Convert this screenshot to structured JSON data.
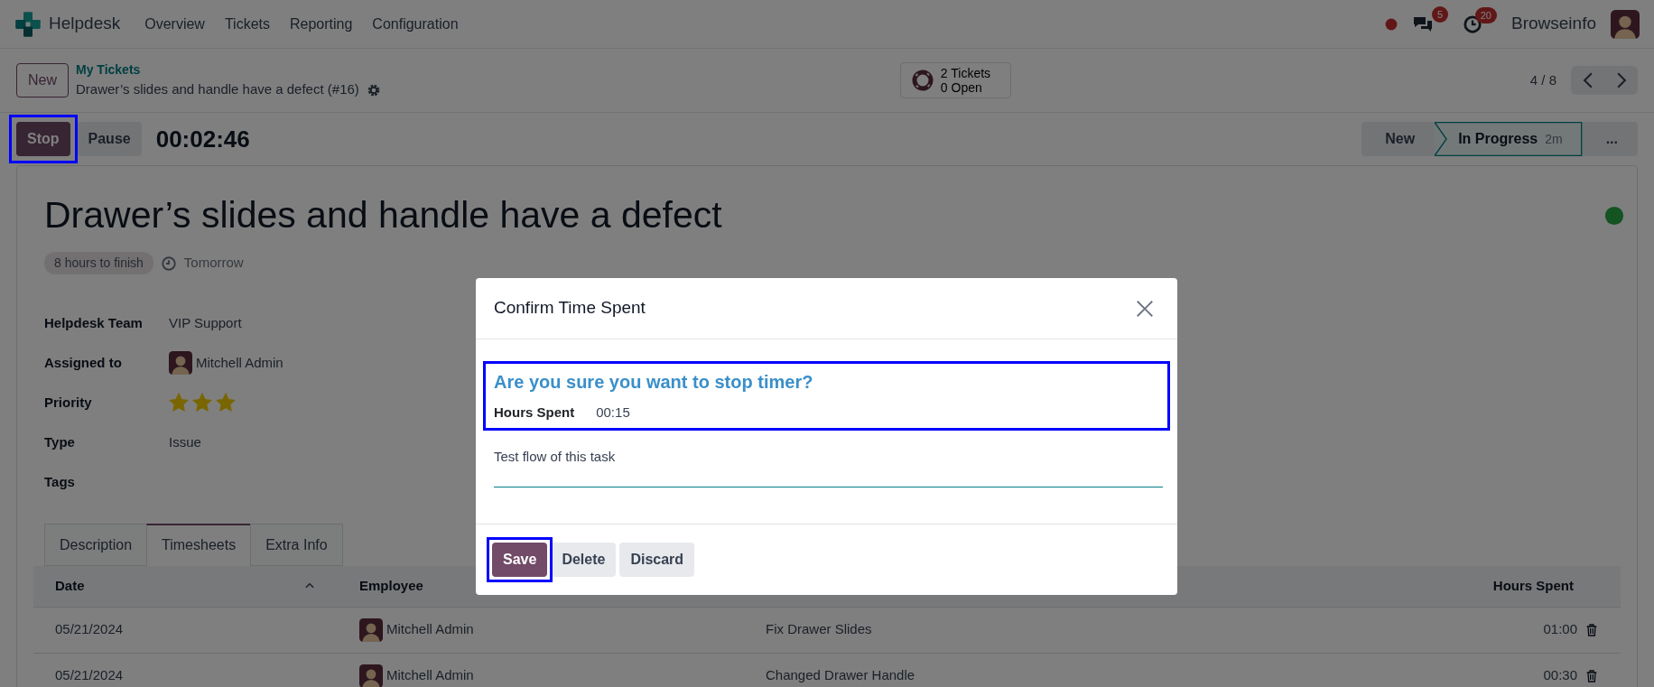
{
  "navbar": {
    "app": "Helpdesk",
    "menus": [
      "Overview",
      "Tickets",
      "Reporting",
      "Configuration"
    ],
    "messages_count": "5",
    "activities_count": "20",
    "user": "Browseinfo"
  },
  "control_panel": {
    "new_button": "New",
    "breadcrumb": "My Tickets",
    "record_title": "Drawer’s slides and handle have a defect (#16)",
    "stat_lines": [
      "2 Tickets",
      "0 Open"
    ],
    "pager": "4 / 8"
  },
  "timer": {
    "buttons": [
      {
        "label": "Stop",
        "kind": "primary",
        "highlighted": true
      },
      {
        "label": "Pause",
        "kind": "secondary",
        "highlighted": false
      }
    ],
    "elapsed": "00:02:46"
  },
  "stages": [
    {
      "label": "New",
      "selected": false
    },
    {
      "label": "In Progress",
      "duration": "2m",
      "selected": true
    },
    {
      "label": "...",
      "selected": false
    }
  ],
  "ticket": {
    "title": "Drawer’s slides and handle have a defect",
    "deadline_badge": "8 hours to finish",
    "deadline": "Tomorrow",
    "fields": [
      {
        "label": "Helpdesk Team",
        "value": "VIP Support",
        "kind": "text"
      },
      {
        "label": "Assigned to",
        "value": "Mitchell Admin",
        "kind": "user"
      },
      {
        "label": "Priority",
        "kind": "stars",
        "stars": 3
      },
      {
        "label": "Type",
        "value": "Issue",
        "kind": "text"
      },
      {
        "label": "Tags",
        "kind": "text"
      }
    ]
  },
  "tabs": [
    {
      "label": "Description",
      "selected": false
    },
    {
      "label": "Timesheets",
      "selected": true
    },
    {
      "label": "Extra Info",
      "selected": false
    }
  ],
  "timesheets": {
    "columns": [
      "Date",
      "Employee",
      "Hours Spent"
    ],
    "rows": [
      {
        "date": "05/21/2024",
        "employee": "Mitchell Admin",
        "description": "Fix Drawer Slides",
        "hours": "01:00"
      },
      {
        "date": "05/21/2024",
        "employee": "Mitchell Admin",
        "description": "Changed Drawer Handle",
        "hours": "00:30"
      }
    ]
  },
  "dialog": {
    "title": "Confirm Time Spent",
    "summary": {
      "question": "Are you sure you want to stop timer?",
      "hours_label": "Hours Spent",
      "hours": "00:15",
      "highlighted": true
    },
    "note": "Test flow of this task",
    "buttons": [
      {
        "label": "Save",
        "kind": "primary",
        "highlighted": true
      },
      {
        "label": "Delete",
        "kind": "secondary",
        "highlighted": false
      },
      {
        "label": "Discard",
        "kind": "secondary",
        "highlighted": false
      }
    ]
  }
}
